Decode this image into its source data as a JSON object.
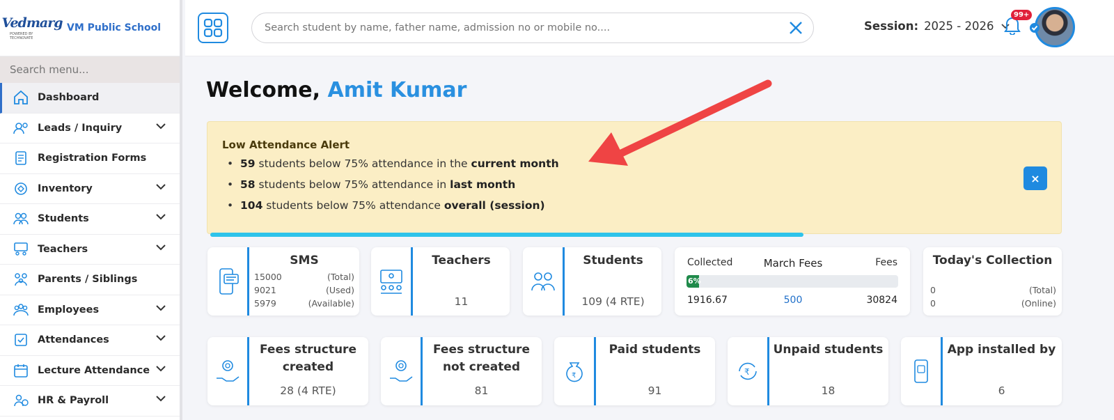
{
  "brand": {
    "logo_text": "Vedmarg",
    "logo_sub": "POWERED BY TECHNOVATE",
    "school_name": "VM Public School"
  },
  "sidebar": {
    "search_placeholder": "Search menu...",
    "items": [
      {
        "label": "Dashboard",
        "icon": "home-icon",
        "expandable": false,
        "active": true
      },
      {
        "label": "Leads / Inquiry",
        "icon": "leads-icon",
        "expandable": true
      },
      {
        "label": "Registration Forms",
        "icon": "form-icon",
        "expandable": false
      },
      {
        "label": "Inventory",
        "icon": "inventory-icon",
        "expandable": true
      },
      {
        "label": "Students",
        "icon": "students-icon",
        "expandable": true
      },
      {
        "label": "Teachers",
        "icon": "teachers-icon",
        "expandable": true
      },
      {
        "label": "Parents / Siblings",
        "icon": "parents-icon",
        "expandable": false
      },
      {
        "label": "Employees",
        "icon": "employees-icon",
        "expandable": true
      },
      {
        "label": "Attendances",
        "icon": "attendance-icon",
        "expandable": true
      },
      {
        "label": "Lecture Attendance",
        "icon": "calendar-icon",
        "expandable": true
      },
      {
        "label": "HR & Payroll",
        "icon": "payroll-icon",
        "expandable": true
      }
    ]
  },
  "topbar": {
    "search_placeholder": "Search student by name, father name, admission no or mobile no....",
    "session_label": "Session:",
    "session_value": "2025 - 2026",
    "notification_badge": "99+"
  },
  "welcome": {
    "prefix": "Welcome,",
    "name": "Amit Kumar"
  },
  "alert": {
    "title": "Low Attendance Alert",
    "lines": [
      {
        "count": "59",
        "text": "students below 75% attendance in the",
        "emph": "current month"
      },
      {
        "count": "58",
        "text": "students below 75% attendance in",
        "emph": "last month"
      },
      {
        "count": "104",
        "text": "students below 75% attendance",
        "emph": "overall (session)"
      }
    ],
    "close_label": "×"
  },
  "cards_row1": {
    "sms": {
      "title": "SMS",
      "rows": [
        {
          "value": "15000",
          "label": "(Total)"
        },
        {
          "value": "9021",
          "label": "(Used)"
        },
        {
          "value": "5979",
          "label": "(Available)"
        }
      ]
    },
    "teachers": {
      "title": "Teachers",
      "value": "11"
    },
    "students": {
      "title": "Students",
      "value": "109 (4 RTE)"
    },
    "fees": {
      "left_label": "Collected",
      "title": "March Fees",
      "right_label": "Fees",
      "percent_label": "6%",
      "percent": 6,
      "collected": "1916.67",
      "middle": "500",
      "total": "30824"
    },
    "today": {
      "title": "Today's Collection",
      "rows": [
        {
          "value": "0",
          "label": "(Total)"
        },
        {
          "value": "0",
          "label": "(Online)"
        }
      ]
    }
  },
  "cards_row2": [
    {
      "title": "Fees structure created",
      "value": "28 (4 RTE)",
      "icon": "award-hand-icon"
    },
    {
      "title": "Fees structure not created",
      "value": "81",
      "icon": "award-hand-icon"
    },
    {
      "title": "Paid students",
      "value": "91",
      "icon": "money-bag-icon"
    },
    {
      "title": "Unpaid students",
      "value": "18",
      "icon": "rupee-refresh-icon"
    },
    {
      "title": "App installed by",
      "value": "6",
      "icon": "mobile-app-icon"
    }
  ],
  "colors": {
    "accent": "#1f8ae0",
    "alert_bg": "#fbeec5",
    "progress": "#2ec3ea",
    "fees_fill": "#1f8a4a"
  }
}
